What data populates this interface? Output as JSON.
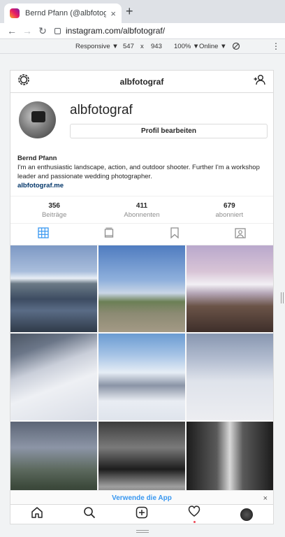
{
  "browser": {
    "tab_title": "Bernd Pfann (@albfotograf) • Ins",
    "tab_close": "×",
    "new_tab": "+",
    "url": "instagram.com/albfotograf/"
  },
  "devtools": {
    "device": "Responsive ▼",
    "width": "547",
    "x": "x",
    "height": "943",
    "zoom": "100% ▼",
    "network": "Online ▼",
    "more": "⋮"
  },
  "header": {
    "title": "albfotograf"
  },
  "profile": {
    "username": "albfotograf",
    "edit_button": "Profil bearbeiten",
    "name": "Bernd Pfann",
    "bio": "I'm an enthusiastic landscape, action, and outdoor shooter. Further I'm a workshop leader and passionate wedding photographer.",
    "link": "albfotograf.me"
  },
  "stats": [
    {
      "num": "356",
      "label": "Beiträge"
    },
    {
      "num": "411",
      "label": "Abonnenten"
    },
    {
      "num": "679",
      "label": "abonniert"
    }
  ],
  "banner": {
    "text": "Verwende die App",
    "close": "×"
  },
  "colors": {
    "accent": "#3897f0",
    "link": "#003569",
    "notification": "#ed4956"
  },
  "icons": [
    "settings-icon",
    "add-person-icon",
    "grid-icon",
    "feed-icon",
    "bookmark-icon",
    "tagged-icon",
    "home-icon",
    "search-icon",
    "new-post-icon",
    "heart-icon",
    "profile-avatar"
  ]
}
